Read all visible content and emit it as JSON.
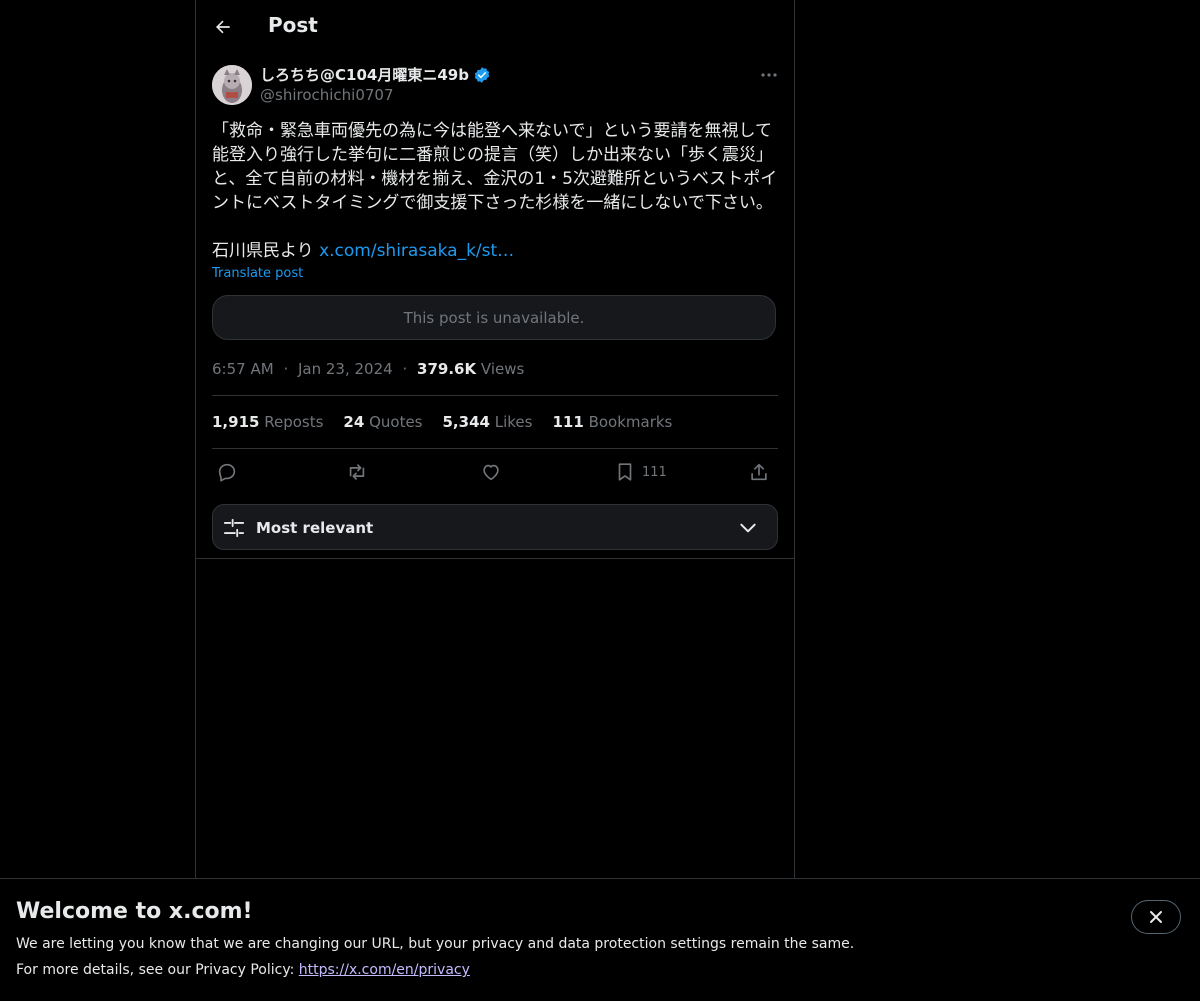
{
  "header": {
    "title": "Post"
  },
  "author": {
    "display_name": "しろちち@C104月曜東ニ49b",
    "handle": "@shirochichi0707",
    "verified": true
  },
  "post": {
    "text": "「救命・緊急車両優先の為に今は能登へ来ないで」という要請を無視して能登入り強行した挙句に二番煎じの提言（笑）しか出来ない「歩く震災」と、全て自前の材料・機材を揃え、金沢の1・5次避難所というベストポイントにベストタイミングで御支援下さった杉様を一緒にしないで下さい。\n\n石川県民より ",
    "link_text": "x.com/shirasaka_k/st…",
    "translate_label": "Translate post",
    "quoted_unavailable": "This post is unavailable.",
    "time": "6:57 AM",
    "date": "Jan 23, 2024",
    "separator": "·",
    "views_count": "379.6K",
    "views_label": "Views"
  },
  "stats": [
    {
      "count": "1,915",
      "label": "Reposts"
    },
    {
      "count": "24",
      "label": "Quotes"
    },
    {
      "count": "5,344",
      "label": "Likes"
    },
    {
      "count": "111",
      "label": "Bookmarks"
    }
  ],
  "actions": {
    "bookmark_count": "111"
  },
  "sort": {
    "label": "Most relevant"
  },
  "banner": {
    "title": "Welcome to x.com!",
    "line1": "We are letting you know that we are changing our URL, but your privacy and data protection settings remain the same.",
    "line2_prefix": "For more details, see our Privacy Policy: ",
    "link": "https://x.com/en/privacy"
  },
  "colors": {
    "accent": "#1d9bf0",
    "background": "#000000",
    "muted": "#71767b",
    "border": "#2f3336"
  }
}
